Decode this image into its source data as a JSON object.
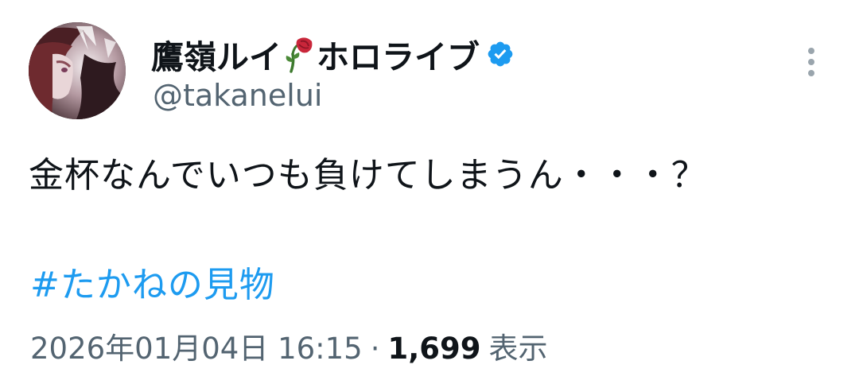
{
  "author": {
    "display_name_prefix": "鷹嶺ルイ",
    "display_name_suffix": "ホロライブ",
    "emoji": "wilted-rose-icon",
    "handle": "@takanelui",
    "verified": true
  },
  "tweet": {
    "text": "金杯なんでいつも負けてしまうん・・・？",
    "hashtag": "#たかねの見物"
  },
  "meta": {
    "timestamp": "2026年01月04日 16:15",
    "separator": "·",
    "views_count": "1,699",
    "views_label": "表示"
  },
  "colors": {
    "text": "#0f1419",
    "secondary": "#536471",
    "link": "#1d9bf0",
    "verified": "#1d9bf0"
  },
  "icons": {
    "more": "more-vertical-icon",
    "verified": "verified-badge-icon"
  }
}
